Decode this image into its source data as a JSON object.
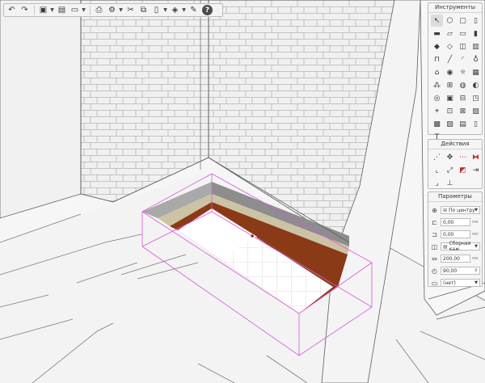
{
  "toolbar": {
    "icons": [
      "undo-icon",
      "redo-icon",
      "view3d-icon",
      "open-icon",
      "save-icon",
      "print-icon",
      "settings-icon",
      "cut-icon",
      "copy-icon",
      "paste-icon",
      "layers-icon",
      "tools-icon",
      "help-icon"
    ],
    "help_label": "?"
  },
  "tools_panel": {
    "title": "Инструменты",
    "items": [
      "T"
    ]
  },
  "actions_panel": {
    "title": "Действия"
  },
  "params_panel": {
    "title": "Параметры",
    "alignment": "По центру",
    "offset_x": "0,00",
    "offset_y": "0,00",
    "unit": "мм",
    "profile": "Сборная каж",
    "thickness": "200,00",
    "angle": "90,00",
    "extra": "(нет)"
  },
  "colors": {
    "layer_brown": "#8a3a17",
    "layer_sand": "#ccc3a5",
    "layer_grey": "#8d8d8d",
    "selection": "#dd55dd"
  }
}
